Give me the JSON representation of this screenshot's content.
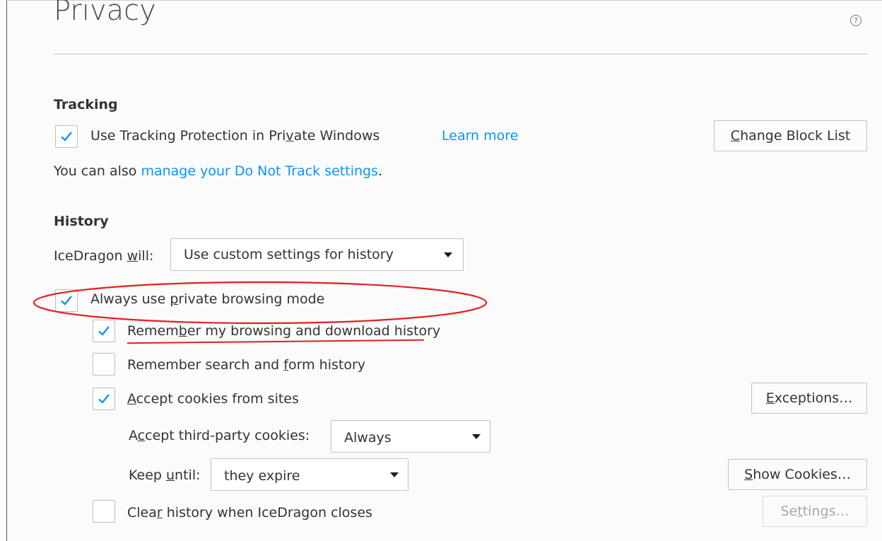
{
  "page": {
    "title": "Privacy",
    "help_icon": "?"
  },
  "tracking": {
    "heading": "Tracking",
    "tp_checkbox": {
      "checked": true,
      "label_pre": "Use Tracking Protection in Pri",
      "label_key": "v",
      "label_post": "ate Windows"
    },
    "learn_more": "Learn more",
    "change_block_list": {
      "key": "C",
      "rest": "hange Block List"
    },
    "dnt_text": "You can also ",
    "dnt_link": "manage your Do Not Track settings",
    "dnt_end": "."
  },
  "history": {
    "heading": "History",
    "will_label": {
      "pre": "IceDragon ",
      "key": "w",
      "post": "ill:"
    },
    "will_select": "Use custom settings for history",
    "private_mode": {
      "checked": true,
      "pre": "Always use ",
      "key": "p",
      "post": "rivate browsing mode"
    },
    "remember_browsing": {
      "checked": true,
      "pre": "Remem",
      "key": "b",
      "post": "er my browsing and download history"
    },
    "remember_search": {
      "checked": false,
      "pre": "Remember search and ",
      "key": "f",
      "post": "orm history"
    },
    "accept_cookies": {
      "checked": true,
      "key": "A",
      "post": "ccept cookies from sites"
    },
    "exceptions": {
      "key": "E",
      "post": "xceptions…"
    },
    "third_party_label": {
      "pre": "A",
      "key": "c",
      "post": "cept third-party cookies:"
    },
    "third_party_select": "Always",
    "keep_until_label": {
      "pre": "Keep ",
      "key": "u",
      "post": "ntil:"
    },
    "keep_until_select": "they expire",
    "show_cookies": {
      "key": "S",
      "post": "how Cookies…"
    },
    "clear_history": {
      "checked": false,
      "pre": "Clea",
      "key": "r",
      "post": " history when IceDragon closes"
    },
    "settings": {
      "pre": "Se",
      "key": "t",
      "post": "tings…"
    }
  },
  "colors": {
    "accent": "#0996f8",
    "annotation": "#e02020"
  }
}
